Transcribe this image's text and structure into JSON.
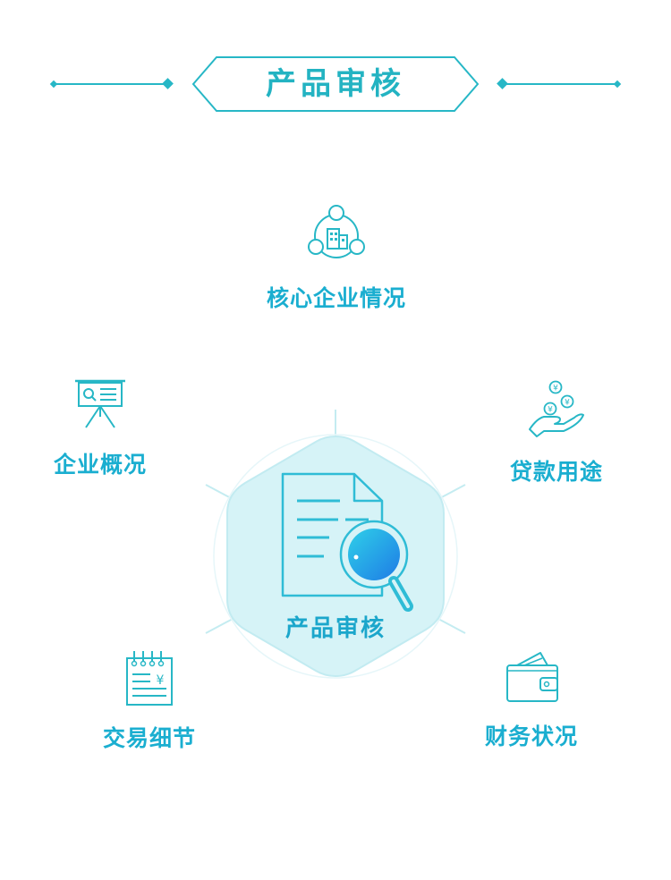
{
  "header": {
    "title": "产品审核"
  },
  "center": {
    "label": "产品审核"
  },
  "nodes": {
    "core_company": "核心企业情况",
    "company_overview": "企业概况",
    "loan_purpose": "贷款用途",
    "transaction_details": "交易细节",
    "financial_status": "财务状况"
  },
  "icons": {
    "core_company": "network-building-icon",
    "company_overview": "presentation-board-icon",
    "loan_purpose": "hand-coins-icon",
    "transaction_details": "notepad-yen-icon",
    "financial_status": "wallet-icon",
    "center": "document-magnifier-icon"
  },
  "currency_symbol": "¥",
  "colors": {
    "accent": "#27b7c6",
    "text": "#1aaed0",
    "center_fill": "#d6f3f7",
    "lens_start": "#2fd0e8",
    "lens_end": "#1e7be6"
  }
}
